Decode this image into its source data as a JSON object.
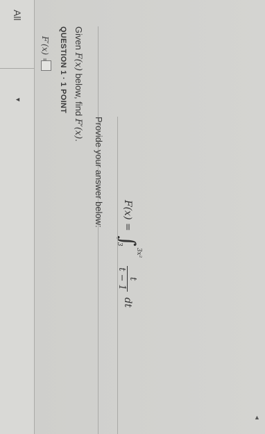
{
  "filter_dropdown": {
    "label": "All",
    "chevron_icon": "chevron-down-icon"
  },
  "question": {
    "header": "QUESTION 1 · 1 POINT",
    "prompt_prefix": "Given ",
    "prompt_fx": "F(x)",
    "prompt_mid": " below, find ",
    "prompt_fpx": "F′(x)",
    "prompt_suffix": "."
  },
  "formula": {
    "lhs": "F(x) =",
    "upper_limit": "3x²",
    "lower_limit": "3",
    "numerator": "t",
    "denominator": "t − 1",
    "differential": "dt"
  },
  "answer": {
    "instruction": "Provide your answer below:",
    "label": "F′(x) ="
  }
}
